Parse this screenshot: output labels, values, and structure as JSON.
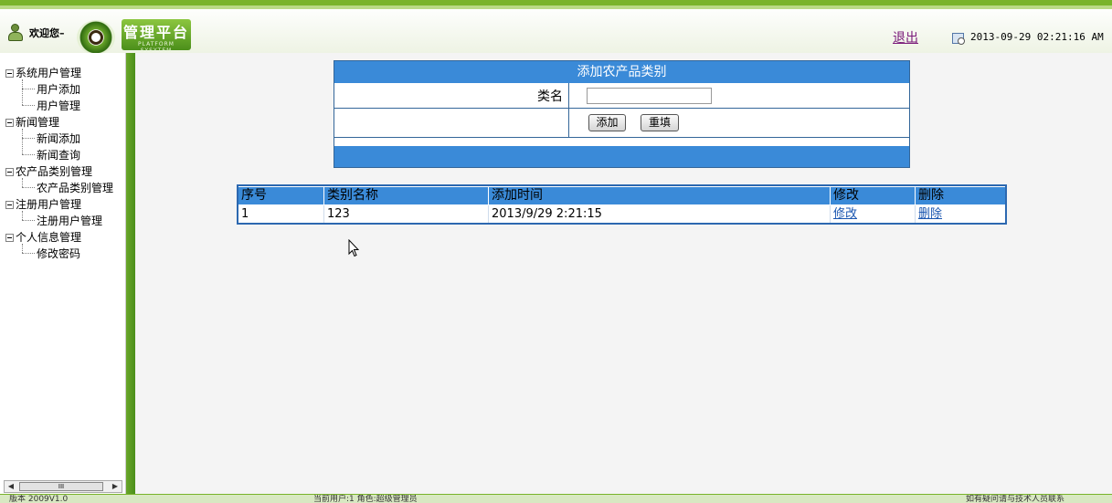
{
  "header": {
    "welcome": "欢迎您–",
    "logo_title": "管理平台",
    "logo_subtitle": "PLATFORM SYSYTEM",
    "logout": "退出",
    "datetime": "2013-09-29 02:21:16 AM"
  },
  "sidebar": {
    "groups": [
      {
        "label": "系统用户管理",
        "items": [
          "用户添加",
          "用户管理"
        ]
      },
      {
        "label": "新闻管理",
        "items": [
          "新闻添加",
          "新闻查询"
        ]
      },
      {
        "label": "农产品类别管理",
        "items": [
          "农产品类别管理"
        ]
      },
      {
        "label": "注册用户管理",
        "items": [
          "注册用户管理"
        ]
      },
      {
        "label": "个人信息管理",
        "items": [
          "修改密码"
        ]
      }
    ],
    "scrollbar_thumb": "III"
  },
  "form": {
    "title": "添加农产品类别",
    "name_label": "类名",
    "name_value": "",
    "add_button": "添加",
    "reset_button": "重填"
  },
  "table": {
    "columns": [
      "序号",
      "类别名称",
      "添加时间",
      "修改",
      "删除"
    ],
    "rows": [
      {
        "id": "1",
        "name": "123",
        "time": "2013/9/29 2:21:15",
        "edit": "修改",
        "delete": "删除"
      }
    ]
  },
  "statusbar": {
    "version": "版本 2009V1.0",
    "current_user": "当前用户:1 角色:超级管理员",
    "help": "如有疑问请与技术人员联系"
  },
  "colors": {
    "accent_green": "#79b32a",
    "header_blue": "#3a8ad8",
    "border_blue": "#2c68b0"
  }
}
